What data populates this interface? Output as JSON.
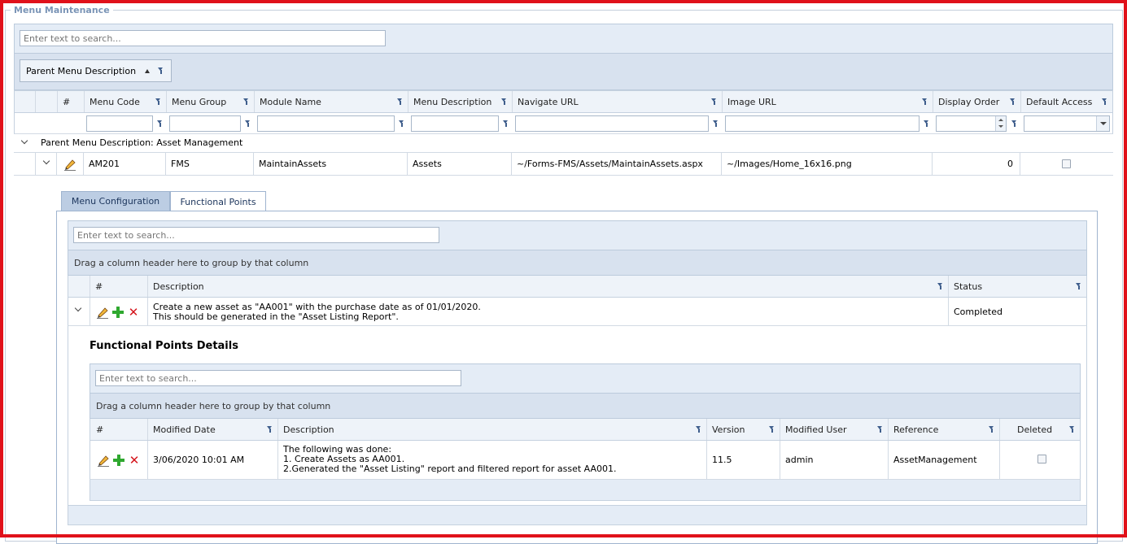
{
  "panel": {
    "title": "Menu Maintenance"
  },
  "main_grid": {
    "search_placeholder": "Enter text to search...",
    "group_chip": "Parent Menu Description",
    "columns": [
      "#",
      "Menu Code",
      "Menu Group",
      "Module Name",
      "Menu Description",
      "Navigate URL",
      "Image URL",
      "Display Order",
      "Default Access"
    ],
    "group_row": "Parent Menu Description: Asset Management",
    "row": {
      "menu_code": "AM201",
      "menu_group": "FMS",
      "module_name": "MaintainAssets",
      "menu_description": "Assets",
      "navigate_url": "~/Forms-FMS/Assets/MaintainAssets.aspx",
      "image_url": "~/Images/Home_16x16.png",
      "display_order": "0"
    }
  },
  "tabs": [
    {
      "label": "Menu Configuration"
    },
    {
      "label": "Functional Points"
    }
  ],
  "fp_grid": {
    "search_placeholder": "Enter text to search...",
    "group_hint": "Drag a column header here to group by that column",
    "columns": [
      "#",
      "Description",
      "Status"
    ],
    "row": {
      "description_line1": "Create a new asset as \"AA001\" with the purchase date as of 01/01/2020.",
      "description_line2": "This should be generated in the \"Asset Listing Report\".",
      "status": "Completed"
    }
  },
  "details": {
    "title": "Functional Points Details",
    "search_placeholder": "Enter text to search...",
    "group_hint": "Drag a column header here to group by that column",
    "columns": [
      "#",
      "Modified Date",
      "Description",
      "Version",
      "Modified User",
      "Reference",
      "Deleted"
    ],
    "row": {
      "modified_date": "3/06/2020 10:01 AM",
      "description_line1": "The following was done:",
      "description_line2": "1. Create Assets as AA001.",
      "description_line3": "2.Generated the \"Asset Listing\" report and filtered report for asset AA001.",
      "version": "11.5",
      "modified_user": "admin",
      "reference": "AssetManagement"
    }
  },
  "colors": {
    "frame": "#e0111a",
    "band": "#e4ecf6",
    "accent": "#3f5e8c",
    "add": "#2fa82f",
    "delete": "#d4141b"
  },
  "icons": [
    "filter-icon",
    "sort-ascending-icon",
    "chevron-down-icon",
    "edit-pencil-icon",
    "add-icon",
    "delete-icon",
    "spin-updown-icon",
    "dropdown-arrow-icon"
  ]
}
